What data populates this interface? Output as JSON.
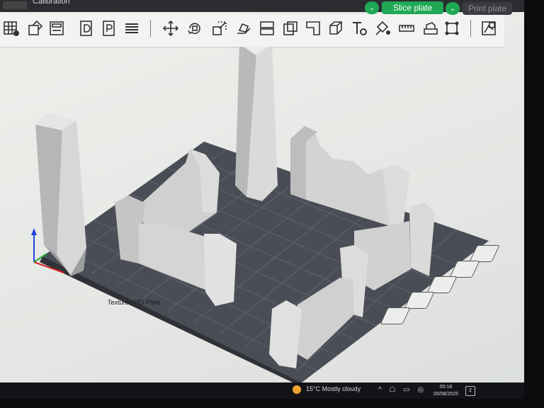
{
  "app": {
    "project_title": "Calibration",
    "slice_button": "Slice plate",
    "print_button": "Print plate",
    "slice_dropdown_glyph": "⌄",
    "print_dropdown_glyph": "⌄"
  },
  "toolbar": {
    "items": [
      {
        "name": "add-plate-icon"
      },
      {
        "name": "auto-orient-icon"
      },
      {
        "name": "arrange-icon"
      },
      {
        "name": "plate-view-d-icon"
      },
      {
        "name": "plate-view-p-icon"
      },
      {
        "name": "layers-icon"
      },
      {
        "name": "move-icon"
      },
      {
        "name": "rotate-icon"
      },
      {
        "name": "scale-icon"
      },
      {
        "name": "lay-on-face-icon"
      },
      {
        "name": "split-icon"
      },
      {
        "name": "cut-icon"
      },
      {
        "name": "boolean-icon"
      },
      {
        "name": "support-paint-icon"
      },
      {
        "name": "seam-paint-icon"
      },
      {
        "name": "text-tool-icon"
      },
      {
        "name": "color-paint-icon"
      },
      {
        "name": "measure-icon"
      },
      {
        "name": "assembly-icon"
      },
      {
        "name": "brim-ears-icon"
      },
      {
        "name": "variable-layer-icon"
      }
    ]
  },
  "viewport": {
    "plate_label": "Textured PEI Plate",
    "side_tools": [
      "close-view-icon",
      "camera-view-icon",
      "object-list-icon",
      "layer-view-icon",
      "orient-view-icon"
    ]
  },
  "taskbar": {
    "weather_temp": "15°C",
    "weather_text": "Mostly cloudy",
    "tray_glyphs": "^ ☖ ▭ ◎",
    "time": "00:18",
    "date": "05/08/2025",
    "notification_count": "2"
  },
  "colors": {
    "accent_green": "#1fa855",
    "bed": "#4a4d54",
    "model": "#d8d8d8",
    "background": "#e8eae7"
  }
}
